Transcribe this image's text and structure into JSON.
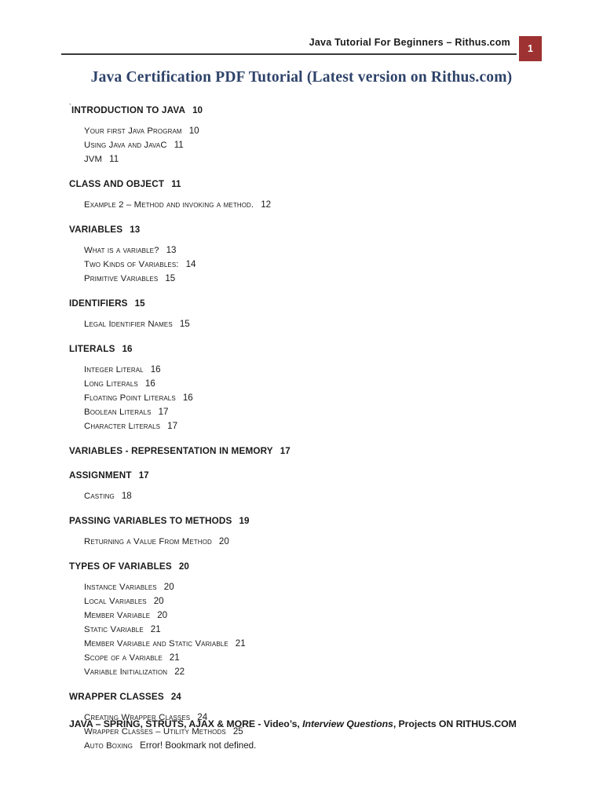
{
  "header": {
    "title": "Java Tutorial For Beginners – Rithus.com",
    "page_number": "1",
    "badge_color": "#9e3232"
  },
  "document": {
    "title": "Java Certification PDF Tutorial (Latest version on Rithus.com)",
    "title_color": "#2e4369"
  },
  "toc": {
    "lead_tick": "`",
    "entries": [
      {
        "level": 1,
        "label": "INTRODUCTION TO JAVA",
        "page": "10"
      },
      {
        "level": 2,
        "label": "Your first Java Program",
        "page": "10"
      },
      {
        "level": 2,
        "label": "Using Java and JavaC",
        "page": "11"
      },
      {
        "level": 2,
        "label": "JVM",
        "page": "11"
      },
      {
        "level": 1,
        "label": "CLASS AND OBJECT",
        "page": "11"
      },
      {
        "level": 2,
        "label": "Example 2 – Method and invoking a method.",
        "page": "12"
      },
      {
        "level": 1,
        "label": "VARIABLES",
        "page": "13"
      },
      {
        "level": 2,
        "label": "What is a variable?",
        "page": "13"
      },
      {
        "level": 2,
        "label": "Two Kinds of Variables:",
        "page": "14"
      },
      {
        "level": 2,
        "label": "Primitive Variables",
        "page": "15"
      },
      {
        "level": 1,
        "label": "IDENTIFIERS",
        "page": "15"
      },
      {
        "level": 2,
        "label": "Legal Identifier Names",
        "page": "15"
      },
      {
        "level": 1,
        "label": "LITERALS",
        "page": "16"
      },
      {
        "level": 2,
        "label": "Integer Literal",
        "page": "16"
      },
      {
        "level": 2,
        "label": "Long Literals",
        "page": "16"
      },
      {
        "level": 2,
        "label": "Floating Point Literals",
        "page": "16"
      },
      {
        "level": 2,
        "label": "Boolean Literals",
        "page": "17"
      },
      {
        "level": 2,
        "label": "Character Literals",
        "page": "17"
      },
      {
        "level": 1,
        "label": "VARIABLES - REPRESENTATION IN MEMORY",
        "page": "17"
      },
      {
        "level": 1,
        "label": "ASSIGNMENT",
        "page": "17"
      },
      {
        "level": 2,
        "label": "Casting",
        "page": "18"
      },
      {
        "level": 1,
        "label": "PASSING VARIABLES TO METHODS",
        "page": "19"
      },
      {
        "level": 2,
        "label": "Returning a Value From Method",
        "page": "20"
      },
      {
        "level": 1,
        "label": "TYPES OF VARIABLES",
        "page": "20"
      },
      {
        "level": 2,
        "label": "Instance Variables",
        "page": "20"
      },
      {
        "level": 2,
        "label": "Local Variables",
        "page": "20"
      },
      {
        "level": 2,
        "label": "Member Variable",
        "page": "20"
      },
      {
        "level": 2,
        "label": "Static Variable",
        "page": "21"
      },
      {
        "level": 2,
        "label": "Member Variable and Static Variable",
        "page": "21"
      },
      {
        "level": 2,
        "label": "Scope of a Variable",
        "page": "21"
      },
      {
        "level": 2,
        "label": "Variable Initialization",
        "page": "22"
      },
      {
        "level": 1,
        "label": "WRAPPER CLASSES",
        "page": "24"
      },
      {
        "level": 2,
        "label": "Creating Wrapper Classes",
        "page": "24"
      },
      {
        "level": 2,
        "label": "Wrapper Classes – Utility Methods",
        "page": "25"
      },
      {
        "level": 2,
        "label": "Auto Boxing",
        "page": "Error! Bookmark not defined."
      }
    ]
  },
  "footer": {
    "part1": "JAVA – SPRING, STRUTS, AJAX & MORE - ",
    "part2": "Video’s, ",
    "part3_italic": "Interview Questions",
    "part4": ", Projects ON RITHUS.COM"
  }
}
